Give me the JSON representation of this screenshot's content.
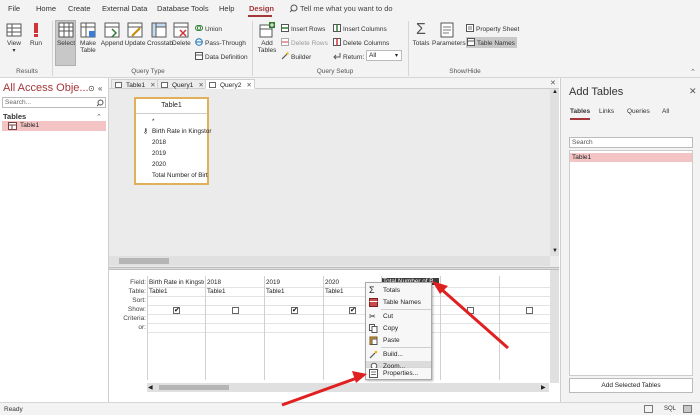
{
  "menu": {
    "items": [
      "File",
      "Home",
      "Create",
      "External Data",
      "Database Tools",
      "Help",
      "Design"
    ],
    "active": "Design",
    "tell_me": "Tell me what you want to do"
  },
  "ribbon": {
    "results": {
      "label": "Results",
      "view": "View",
      "run": "Run"
    },
    "query_type": {
      "label": "Query Type",
      "select": "Select",
      "make_table_1": "Make",
      "make_table_2": "Table",
      "append": "Append",
      "update": "Update",
      "crosstab": "Crosstab",
      "delete": "Delete",
      "union": "Union",
      "pass_through": "Pass-Through",
      "data_definition": "Data Definition"
    },
    "query_setup": {
      "label": "Query Setup",
      "add_tables_1": "Add",
      "add_tables_2": "Tables",
      "insert_rows": "Insert Rows",
      "delete_rows": "Delete Rows",
      "builder": "Builder",
      "insert_columns": "Insert Columns",
      "delete_columns": "Delete Columns",
      "return_label": "Return:",
      "return_value": "All"
    },
    "show_hide": {
      "label": "Show/Hide",
      "totals": "Totals",
      "parameters": "Parameters",
      "property_sheet": "Property Sheet",
      "table_names": "Table Names"
    }
  },
  "nav": {
    "title": "All Access Obje...",
    "search_placeholder": "Search...",
    "section": "Tables",
    "items": [
      "Table1"
    ]
  },
  "tabs": [
    "Table1",
    "Query1",
    "Query2"
  ],
  "active_tab": "Query2",
  "table_box": {
    "title": "Table1",
    "fields": [
      "*",
      "Birth Rate in Kingstor",
      "2018",
      "2019",
      "2020",
      "Total Number of Birt"
    ]
  },
  "grid": {
    "row_labels": [
      "Field:",
      "Table:",
      "Sort:",
      "Show:",
      "Criteria:",
      "or:"
    ],
    "columns": [
      {
        "field": "Birth Rate in Kingstor",
        "table": "Table1",
        "show": true
      },
      {
        "field": "2018",
        "table": "Table1",
        "show": false
      },
      {
        "field": "2019",
        "table": "Table1",
        "show": true
      },
      {
        "field": "2020",
        "table": "Table1",
        "show": true
      },
      {
        "field": "Total Number of B",
        "table": "",
        "show": false
      },
      {
        "field": "",
        "table": "",
        "show": false
      }
    ]
  },
  "context_menu": {
    "items": [
      "Totals",
      "Table Names",
      "Cut",
      "Copy",
      "Paste",
      "Build...",
      "Zoom...",
      "Properties..."
    ],
    "highlighted": "Zoom..."
  },
  "add_tables": {
    "title": "Add Tables",
    "tabs": [
      "Tables",
      "Links",
      "Queries",
      "All"
    ],
    "search_placeholder": "Search",
    "items": [
      "Table1"
    ],
    "button": "Add Selected Tables"
  },
  "status": {
    "text": "Ready",
    "sql_label": "SQL"
  },
  "colors": {
    "accent": "#a4373a",
    "selection": "#f4c3c4",
    "highlight_border": "#e0b05a",
    "arrow": "#e02020"
  }
}
